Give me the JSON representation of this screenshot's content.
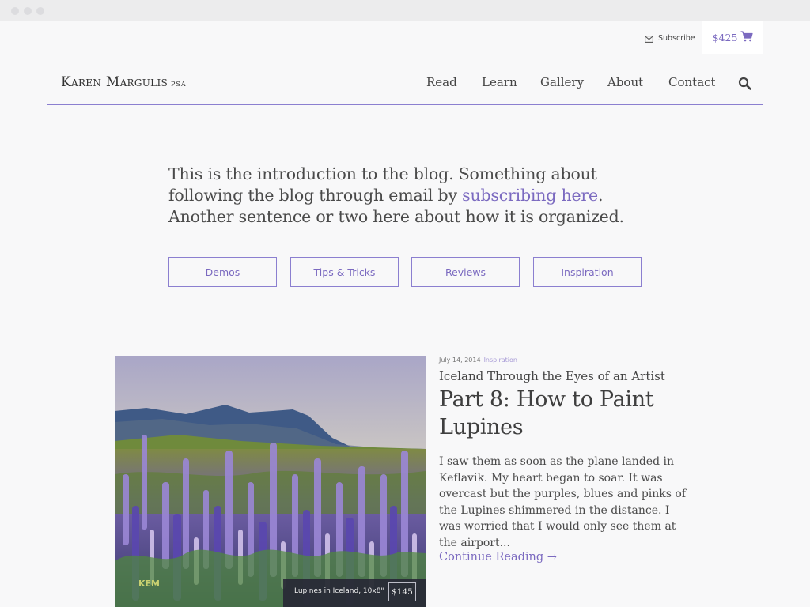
{
  "window": {
    "controls": [
      "close-dot",
      "minimize-dot",
      "maximize-dot"
    ]
  },
  "utility": {
    "subscribe_label": "Subscribe",
    "subscribe_icon": "envelope-icon",
    "cart_amount": "$425",
    "cart_icon": "shopping-cart-icon"
  },
  "site": {
    "name": "Karen Margulis",
    "suffix": "PSA"
  },
  "nav": {
    "items": [
      {
        "label": "Read"
      },
      {
        "label": "Learn"
      },
      {
        "label": "Gallery"
      },
      {
        "label": "About"
      },
      {
        "label": "Contact"
      }
    ],
    "search_icon": "search-icon"
  },
  "intro": {
    "text_before": "This is the introduction to the blog. Something about following the blog through email by ",
    "link_text": "subscribing here",
    "text_after": ". Another sentence or two here about how it is organized."
  },
  "categories": [
    {
      "label": "Demos"
    },
    {
      "label": "Tips & Tricks"
    },
    {
      "label": "Reviews"
    },
    {
      "label": "Inspiration"
    }
  ],
  "post": {
    "date": "July 14, 2014",
    "category": "Inspiration",
    "series": "Iceland Through the Eyes of an Artist",
    "title": "Part 8: How to Paint Lupines",
    "excerpt": "I saw them as soon as the plane landed in Keflavik. My heart began to soar. It was overcast but the purples, blues and pinks of the Lupines shimmered in the distance. I was worried that I would only see them at the airport...",
    "continue_label": "Continue Reading →",
    "image": {
      "subject": "pastel painting of purple lupine field with mountains",
      "caption": "Lupines in Iceland, 10x8\"",
      "price": "$145",
      "signature": "KEM"
    }
  },
  "colors": {
    "accent": "#7b6ac0",
    "rule": "#8b7fd0",
    "background": "#f8f8f9",
    "text": "#4a4a4a"
  }
}
